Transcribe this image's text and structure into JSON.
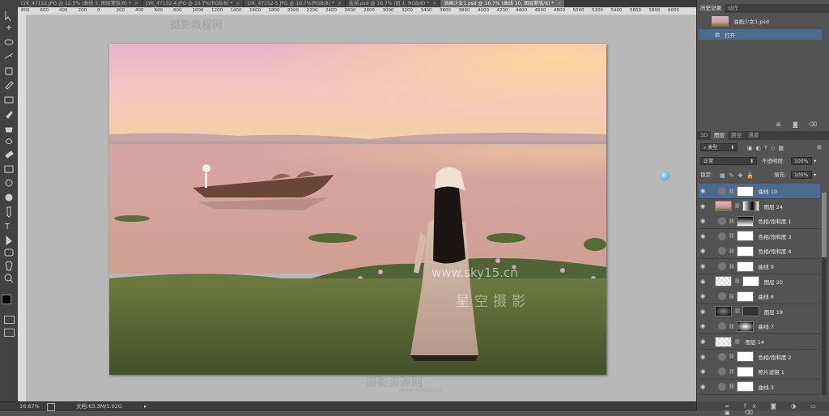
{
  "tabs": [
    {
      "label": "LYK_47152.JPG @ 12.5% (曲线 5, 图层蒙版/8) *",
      "close": "×"
    },
    {
      "label": "LYK_47152-4.JPG @ 16.7%(RGB/8) *",
      "close": "×"
    },
    {
      "label": "LYK_47152-5.JPG @ 16.7%(RGB/8) *",
      "close": "×"
    },
    {
      "label": "盐湖.psd @ 16.7% (组 1, RGB/8) *",
      "close": "×"
    },
    {
      "label": "油画少女1.psd @ 16.7% (曲线 10, 图层蒙版/8) *",
      "close": "×"
    }
  ],
  "ruler_ticks": [
    "800",
    "600",
    "400",
    "200",
    "0",
    "200",
    "400",
    "600",
    "800",
    "1000",
    "1200",
    "1400",
    "1600",
    "1800",
    "2000",
    "2200",
    "2400",
    "2600",
    "2800",
    "3000",
    "3200",
    "3400",
    "3600",
    "3800",
    "4000",
    "4200",
    "4400",
    "4600",
    "4800",
    "5000",
    "5200",
    "5400",
    "5600",
    "5800",
    "6000"
  ],
  "watermarks": {
    "top": "摄影教程网",
    "site": "www.sky15.cn",
    "signature": "星空摄影",
    "bottom": "摄影资源网",
    "bottom_url": "www.sysyzy.cn"
  },
  "status": {
    "zoom": "16.67%",
    "doc": "文档:63.3M/1.02G"
  },
  "history_panel": {
    "tabs": [
      "历史记录",
      "动作"
    ],
    "snapshot": "油画少女1.psd",
    "steps": [
      "打开"
    ]
  },
  "layers_panel": {
    "tabs": [
      "3D",
      "图层",
      "路径",
      "通道"
    ],
    "filter_label": "类型",
    "blend_mode": "正常",
    "opacity_label": "不透明度:",
    "opacity_value": "100%",
    "lock_label": "锁定:",
    "fill_label": "填充:",
    "fill_value": "100%",
    "layers": [
      {
        "name": "曲线 10",
        "selected": true
      },
      {
        "name": "图层 24",
        "selected": false
      },
      {
        "name": "色相/饱和度 1",
        "selected": false
      },
      {
        "name": "色相/饱和度 3",
        "selected": false
      },
      {
        "name": "色相/饱和度 4",
        "selected": false
      },
      {
        "name": "曲线 9",
        "selected": false
      },
      {
        "name": "图层 20",
        "selected": false
      },
      {
        "name": "曲线 8",
        "selected": false
      },
      {
        "name": "图层 19",
        "selected": false
      },
      {
        "name": "曲线 7",
        "selected": false
      },
      {
        "name": "图层 14",
        "selected": false
      },
      {
        "name": "色相/饱和度 2",
        "selected": false
      },
      {
        "name": "照片滤镜 1",
        "selected": false
      },
      {
        "name": "曲线 3",
        "selected": false
      }
    ],
    "footer_icons": [
      "link-icon",
      "fx-icon",
      "mask-icon",
      "adjustment-icon",
      "folder-icon",
      "new-layer-icon",
      "trash-icon"
    ]
  },
  "colors": {
    "selection": "#4c6b8f",
    "sky_top": "#e8b8c8",
    "sky_horizon": "#f7cfa4",
    "water": "#d9a996",
    "grass": "#5a6b32"
  }
}
